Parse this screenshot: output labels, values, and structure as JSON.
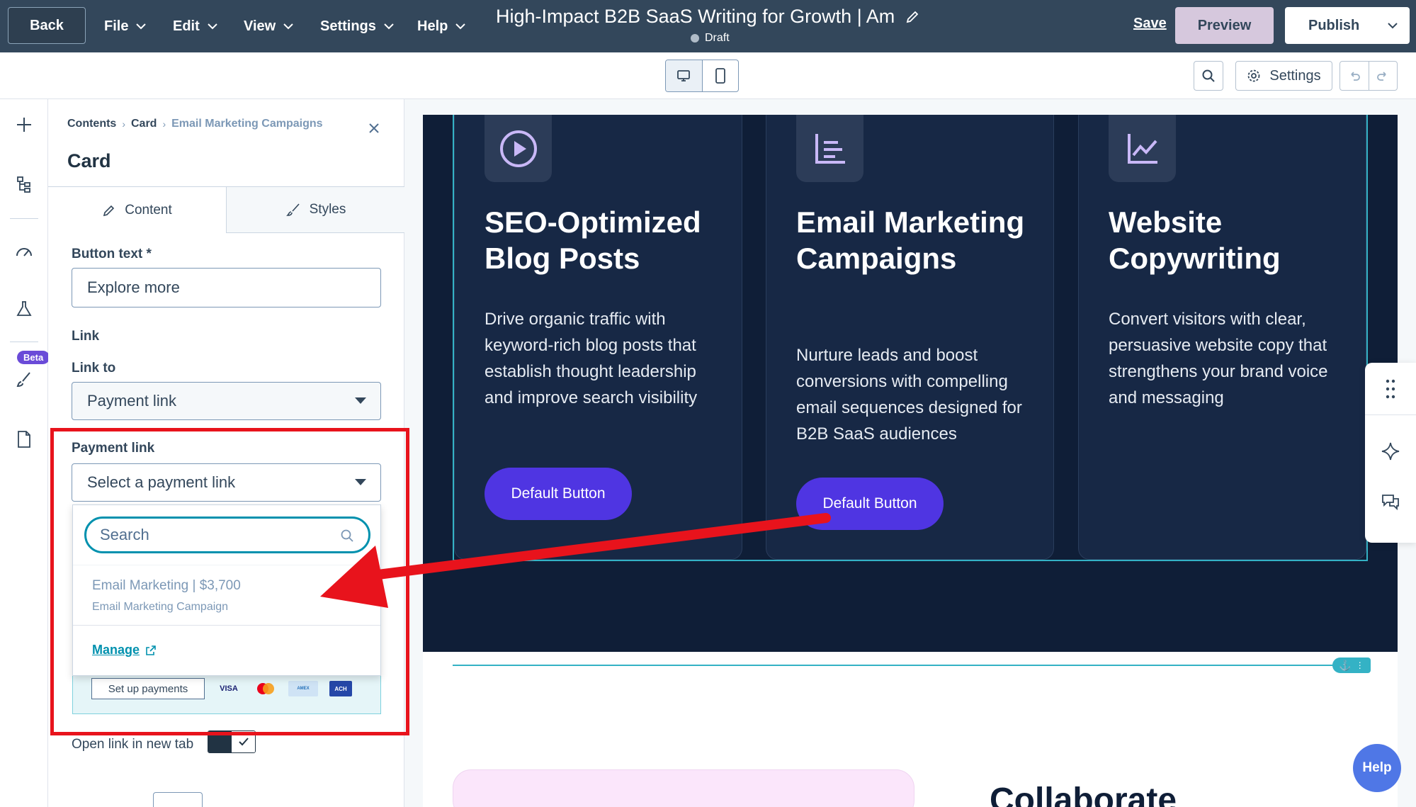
{
  "topbar": {
    "back_label": "Back",
    "menus": [
      "File",
      "Edit",
      "View",
      "Settings",
      "Help"
    ],
    "doc_title": "High-Impact B2B SaaS Writing for Growth | Am",
    "status": "Draft",
    "save_label": "Save",
    "preview_label": "Preview",
    "publish_label": "Publish"
  },
  "toolbar": {
    "settings_label": "Settings"
  },
  "rail": {
    "beta_label": "Beta"
  },
  "panel": {
    "breadcrumb": [
      "Contents",
      "Card",
      "Email Marketing Campaigns"
    ],
    "title": "Card",
    "tabs": [
      "Content",
      "Styles"
    ],
    "button_text_label": "Button text *",
    "button_text_value": "Explore more",
    "link_heading": "Link",
    "link_to_label": "Link to",
    "link_to_value": "Payment link",
    "payment_link_label": "Payment link",
    "payment_link_placeholder": "Select a payment link",
    "dropdown": {
      "search_placeholder": "Search",
      "option_title": "Email Marketing | $3,700",
      "option_subtitle": "Email Marketing Campaign",
      "manage_label": "Manage"
    },
    "setup_payments_label": "Set up payments",
    "card_brands": [
      "VISA",
      "mastercard",
      "AMERICAN EXPRESS",
      "ACH"
    ],
    "open_new_tab_label": "Open link in new tab",
    "open_new_tab_checked": true
  },
  "canvas": {
    "cards": [
      {
        "icon": "play-circle-icon",
        "title": "SEO-Optimized Blog Posts",
        "description": "Drive organic traffic with keyword-rich blog posts that establish thought leadership and improve search visibility",
        "button": "Default Button"
      },
      {
        "icon": "list-lines-icon",
        "title": "Email Marketing Campaigns",
        "description": "Nurture leads and boost conversions with compelling email sequences designed for B2B SaaS audiences",
        "button": "Default Button"
      },
      {
        "icon": "line-chart-icon",
        "title": "Website Copywriting",
        "description": "Convert visitors with clear, persuasive website copy that strengthens your brand voice and messaging",
        "button": "Default Button"
      }
    ],
    "lower_heading": "Collaborate"
  },
  "help_label": "Help",
  "colors": {
    "topbar": "#33475b",
    "accent_teal": "#0091ae",
    "card_button": "#4f35e2",
    "dark_section": "#0f1e37",
    "annotation_red": "#e8131c"
  }
}
